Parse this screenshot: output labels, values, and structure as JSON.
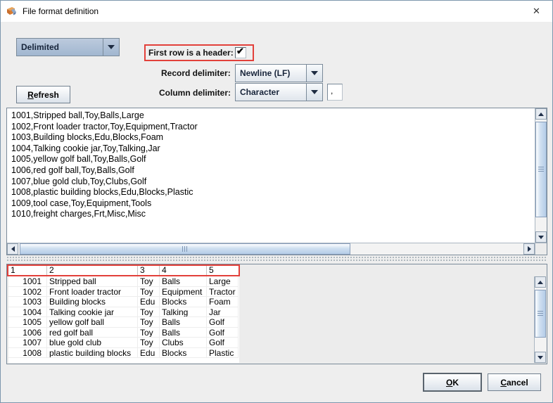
{
  "window": {
    "title": "File format definition",
    "close_glyph": "✕"
  },
  "controls": {
    "format_combo": {
      "value": "Delimited"
    },
    "header_row": {
      "label": "First row is a header:",
      "check_glyph": "✔"
    },
    "record_delimiter": {
      "label": "Record delimiter:",
      "value": "Newline (LF)"
    },
    "column_delimiter": {
      "label": "Column delimiter:",
      "value": "Character",
      "char": ","
    },
    "refresh_button": {
      "label": "Refresh"
    }
  },
  "raw_preview": {
    "lines": [
      "1001,Stripped ball,Toy,Balls,Large",
      "1002,Front loader tractor,Toy,Equipment,Tractor",
      "1003,Building blocks,Edu,Blocks,Foam",
      "1004,Talking cookie jar,Toy,Talking,Jar",
      "1005,yellow golf ball,Toy,Balls,Golf",
      "1006,red golf ball,Toy,Balls,Golf",
      "1007,blue gold club,Toy,Clubs,Golf",
      "1008,plastic building blocks,Edu,Blocks,Plastic",
      "1009,tool case,Toy,Equipment,Tools",
      "1010,freight charges,Frt,Misc,Misc"
    ]
  },
  "preview_table": {
    "columns": [
      "1",
      "2",
      "3",
      "4",
      "5"
    ],
    "rows": [
      [
        "1001",
        "Stripped ball",
        "Toy",
        "Balls",
        "Large"
      ],
      [
        "1002",
        "Front loader tractor",
        "Toy",
        "Equipment",
        "Tractor"
      ],
      [
        "1003",
        "Building blocks",
        "Edu",
        "Blocks",
        "Foam"
      ],
      [
        "1004",
        "Talking cookie jar",
        "Toy",
        "Talking",
        "Jar"
      ],
      [
        "1005",
        "yellow golf ball",
        "Toy",
        "Balls",
        "Golf"
      ],
      [
        "1006",
        "red golf ball",
        "Toy",
        "Balls",
        "Golf"
      ],
      [
        "1007",
        "blue gold club",
        "Toy",
        "Clubs",
        "Golf"
      ],
      [
        "1008",
        "plastic building blocks",
        "Edu",
        "Blocks",
        "Plastic"
      ]
    ]
  },
  "footer": {
    "ok_label": "OK",
    "cancel_label": "Cancel"
  },
  "colors": {
    "highlight_red": "#e2403a",
    "combo_blue": "#a9bfd7",
    "dialog_bg": "#eeeeee"
  }
}
